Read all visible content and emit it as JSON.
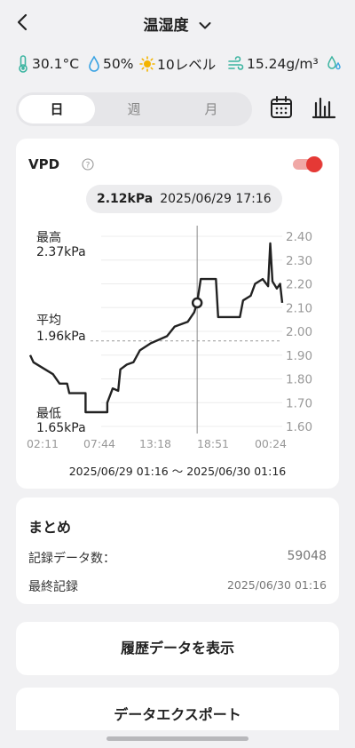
{
  "header": {
    "title": "温湿度"
  },
  "stats": {
    "temperature": "30.1°C",
    "humidity": "50%",
    "light": "10レベル",
    "absolute_humidity": "15.24g/m³"
  },
  "tabs": [
    {
      "label": "日",
      "active": true
    },
    {
      "label": "週",
      "active": false
    },
    {
      "label": "月",
      "active": false
    }
  ],
  "vpd": {
    "title": "VPD",
    "toggle_on": true,
    "selected_value": "2.12kPa",
    "selected_time": "2025/06/29 17:16",
    "max_label": "最高",
    "max_value": "2.37kPa",
    "avg_label": "平均",
    "avg_value": "1.96kPa",
    "min_label": "最低",
    "min_value": "1.65kPa",
    "range": "2025/06/29 01:16 〜 2025/06/30 01:16"
  },
  "chart_data": {
    "type": "line",
    "x_ticks": [
      "02:11",
      "07:44",
      "13:18",
      "18:51",
      "00:24"
    ],
    "y_ticks": [
      "2.40",
      "2.30",
      "2.20",
      "2.10",
      "2.00",
      "1.90",
      "1.80",
      "1.70",
      "1.60"
    ],
    "ylim": [
      1.6,
      2.4
    ],
    "series": [
      {
        "values": [
          [
            1.9,
            1.9
          ],
          [
            2.2,
            1.87
          ],
          [
            4.0,
            1.82
          ],
          [
            4.6,
            1.78
          ],
          [
            5.3,
            1.78
          ],
          [
            5.5,
            1.74
          ],
          [
            7.0,
            1.74
          ],
          [
            7.0,
            1.66
          ],
          [
            9.0,
            1.66
          ],
          [
            9.0,
            1.7
          ],
          [
            9.5,
            1.76
          ],
          [
            10.0,
            1.75
          ],
          [
            10.2,
            1.84
          ],
          [
            10.8,
            1.86
          ],
          [
            11.4,
            1.87
          ],
          [
            12.0,
            1.92
          ],
          [
            13.0,
            1.95
          ],
          [
            14.5,
            1.98
          ],
          [
            15.2,
            2.02
          ],
          [
            16.4,
            2.04
          ],
          [
            17.0,
            2.08
          ],
          [
            17.27,
            2.12
          ],
          [
            17.6,
            2.22
          ],
          [
            19.0,
            2.22
          ],
          [
            19.2,
            2.06
          ],
          [
            21.2,
            2.06
          ],
          [
            21.5,
            2.13
          ],
          [
            22.2,
            2.15
          ],
          [
            22.6,
            2.2
          ],
          [
            23.3,
            2.22
          ],
          [
            23.8,
            2.19
          ],
          [
            24.0,
            2.37
          ],
          [
            24.2,
            2.21
          ],
          [
            24.6,
            2.18
          ],
          [
            24.9,
            2.2
          ],
          [
            25.1,
            2.12
          ]
        ]
      }
    ],
    "average": 1.96,
    "selected": {
      "x": 17.27,
      "y": 2.12
    }
  },
  "summary": {
    "title": "まとめ",
    "records_label": "記録データ数：",
    "records_value": "59048",
    "last_label": "最終記録",
    "last_value": "2025/06/30 01:16"
  },
  "buttons": {
    "history": "履歴データを表示",
    "export": "データエクスポート"
  },
  "colors": {
    "accent": "#e53935",
    "line": "#222222",
    "water": "#3aa3e3",
    "sun": "#f4b400",
    "wind": "#3bb4a0"
  }
}
